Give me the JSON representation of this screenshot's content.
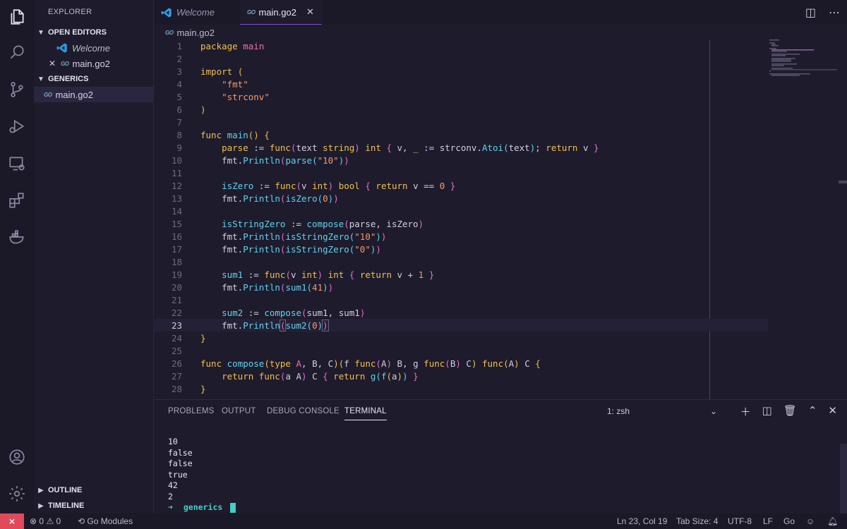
{
  "sidebar": {
    "title": "EXPLORER",
    "open_editors": "OPEN EDITORS",
    "open_items": [
      "Welcome",
      "main.go2"
    ],
    "folder": "GENERICS",
    "folder_items": [
      "main.go2"
    ],
    "outline": "OUTLINE",
    "timeline": "TIMELINE"
  },
  "tabs": [
    {
      "label": "Welcome"
    },
    {
      "label": "main.go2"
    }
  ],
  "breadcrumb": "main.go2",
  "go_icon": "GO",
  "editor": {
    "line_numbers": [
      "1",
      "2",
      "3",
      "4",
      "5",
      "6",
      "7",
      "8",
      "9",
      "10",
      "11",
      "12",
      "13",
      "14",
      "15",
      "16",
      "17",
      "18",
      "19",
      "20",
      "21",
      "22",
      "23",
      "24",
      "25",
      "26",
      "27",
      "28"
    ]
  },
  "panel": {
    "tabs": [
      "PROBLEMS",
      "OUTPUT",
      "DEBUG CONSOLE",
      "TERMINAL"
    ],
    "terminal_select": "1: zsh",
    "output": [
      "10",
      "false",
      "false",
      "true",
      "42",
      "2"
    ],
    "prompt_arrow": "➜",
    "prompt_dir": "generics"
  },
  "status": {
    "errors": "0",
    "warnings": "0",
    "go_modules": "Go Modules",
    "position": "Ln 23, Col 19",
    "tab_size": "Tab Size: 4",
    "encoding": "UTF-8",
    "eol": "LF",
    "language": "Go"
  },
  "colors": {
    "accent": "#7a4fd8",
    "remote": "#e04a5a",
    "keyword": "#f1c04c",
    "function": "#5fd4f0",
    "string": "#f49b6a"
  }
}
